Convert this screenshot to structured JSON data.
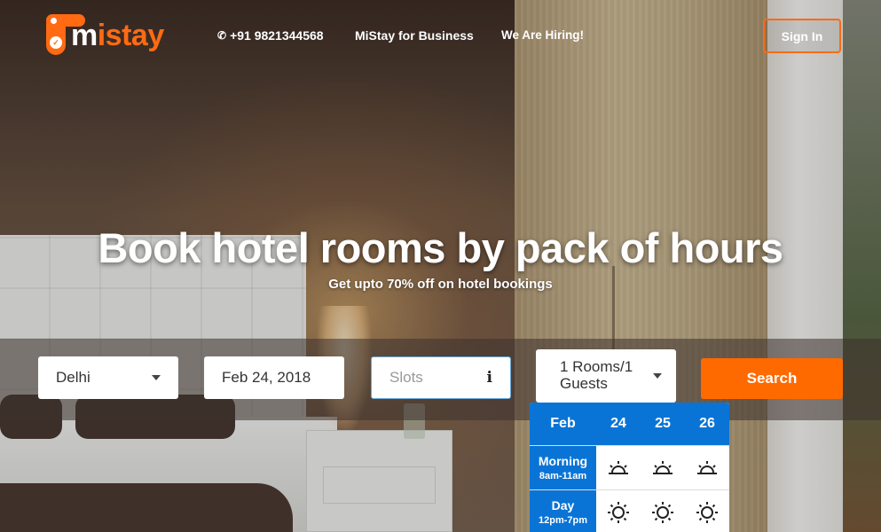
{
  "header": {
    "logo_text_m": "m",
    "logo_text_rest": "istay",
    "phone": "+91 9821344568",
    "phone_icon": "phone-icon",
    "business_link": "MiStay for Business",
    "hiring_link": "We Are Hiring!",
    "signin_label": "Sign In"
  },
  "hero": {
    "headline": "Book hotel rooms by pack of hours",
    "subline": "Get upto 70% off on hotel bookings"
  },
  "search": {
    "city": "Delhi",
    "date": "Feb 24, 2018",
    "slots_placeholder": "Slots",
    "slots_info_icon": "info-icon",
    "rooms": "1 Rooms/1 Guests",
    "search_label": "Search"
  },
  "slot_picker": {
    "month": "Feb",
    "days": [
      "24",
      "25",
      "26"
    ],
    "rows": [
      {
        "label": "Morning",
        "time": "8am-11am",
        "icon": "sunrise-icon"
      },
      {
        "label": "Day",
        "time": "12pm-7pm",
        "icon": "sun-icon"
      }
    ]
  },
  "colors": {
    "brand_orange": "#ff6a13",
    "slot_blue": "#0a74d6"
  }
}
